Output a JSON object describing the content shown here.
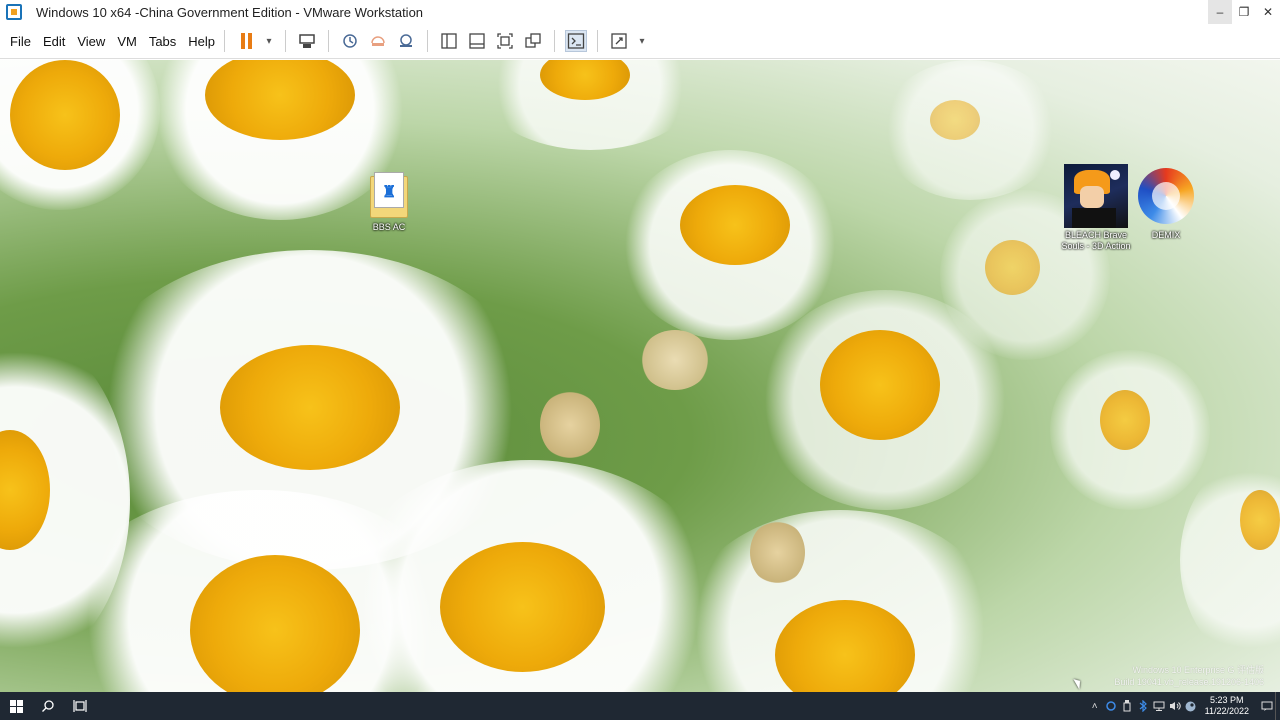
{
  "window": {
    "title": "Windows 10 x64 -China Government Edition - VMware Workstation",
    "controls": {
      "minimize": "–",
      "restore": "❐",
      "close": "✕"
    }
  },
  "menu": {
    "items": [
      "File",
      "Edit",
      "View",
      "VM",
      "Tabs",
      "Help"
    ]
  },
  "toolbar": {
    "icons": [
      "pause-icon",
      "dropdown-arrow-icon",
      "send-ctrl-alt-del-icon",
      "snapshot-icon",
      "revert-snapshot-icon",
      "snapshot-manager-icon",
      "library-icon",
      "thumbnail-icon",
      "full-screen-icon",
      "unity-icon",
      "console-view-icon",
      "stretch-icon",
      "dropdown-arrow-icon"
    ],
    "arrow": "▾"
  },
  "desktop": {
    "icons": [
      {
        "label": "BBS AC",
        "icon": "folder-icon"
      },
      {
        "label": "BLEACH Brave Souls - 3D Action",
        "icon": "bleach-game-icon"
      },
      {
        "label": "DEMIX",
        "icon": "demix-icon"
      }
    ],
    "watermark": {
      "line1": "Windows 10 Enterprise G 评估版",
      "line2": "Build 19041.vb_release.191206-1406"
    }
  },
  "taskbar": {
    "clock_time": "5:23 PM",
    "clock_date": "11/22/2022",
    "tray_icons": [
      "chevron-up-icon",
      "app-tray-icon",
      "usb-icon",
      "bluetooth-icon",
      "network-icon",
      "volume-icon",
      "steam-icon"
    ]
  },
  "colors": {
    "accent_pause": "#e87c14",
    "taskbar_bg": "#1f2833"
  }
}
